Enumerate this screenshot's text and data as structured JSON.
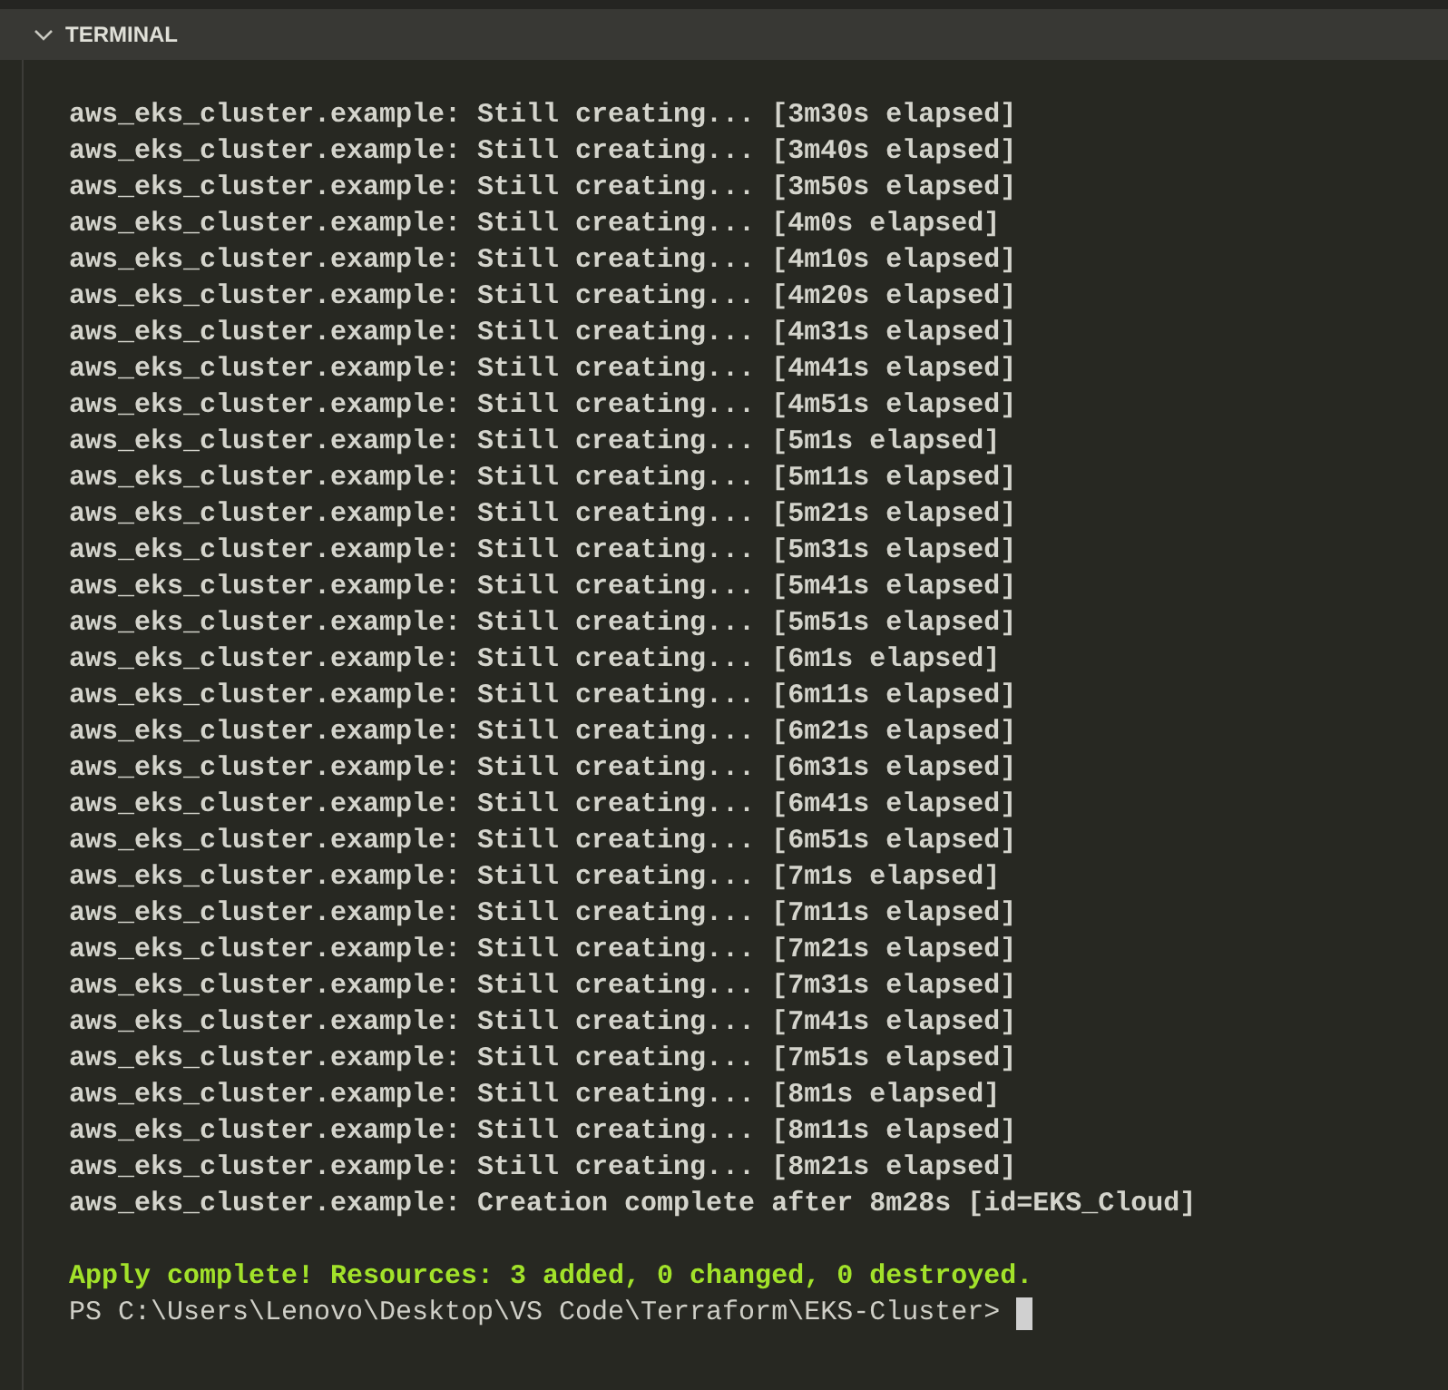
{
  "panel": {
    "title": "TERMINAL",
    "expanded": true
  },
  "terminal": {
    "blocks": [
      [
        {
          "kind": "output",
          "text": "aws_eks_cluster.example: Still creating... [3m30s elapsed]"
        },
        {
          "kind": "output",
          "text": "aws_eks_cluster.example: Still creating... [3m40s elapsed]"
        },
        {
          "kind": "output",
          "text": "aws_eks_cluster.example: Still creating... [3m50s elapsed]"
        },
        {
          "kind": "output",
          "text": "aws_eks_cluster.example: Still creating... [4m0s elapsed]"
        },
        {
          "kind": "output",
          "text": "aws_eks_cluster.example: Still creating... [4m10s elapsed]"
        },
        {
          "kind": "output",
          "text": "aws_eks_cluster.example: Still creating... [4m20s elapsed]"
        },
        {
          "kind": "output",
          "text": "aws_eks_cluster.example: Still creating... [4m31s elapsed]"
        },
        {
          "kind": "output",
          "text": "aws_eks_cluster.example: Still creating... [4m41s elapsed]"
        },
        {
          "kind": "output",
          "text": "aws_eks_cluster.example: Still creating... [4m51s elapsed]"
        },
        {
          "kind": "output",
          "text": "aws_eks_cluster.example: Still creating... [5m1s elapsed]"
        },
        {
          "kind": "output",
          "text": "aws_eks_cluster.example: Still creating... [5m11s elapsed]"
        },
        {
          "kind": "output",
          "text": "aws_eks_cluster.example: Still creating... [5m21s elapsed]"
        },
        {
          "kind": "output",
          "text": "aws_eks_cluster.example: Still creating... [5m31s elapsed]"
        },
        {
          "kind": "output",
          "text": "aws_eks_cluster.example: Still creating... [5m41s elapsed]"
        },
        {
          "kind": "output",
          "text": "aws_eks_cluster.example: Still creating... [5m51s elapsed]"
        },
        {
          "kind": "output",
          "text": "aws_eks_cluster.example: Still creating... [6m1s elapsed]"
        },
        {
          "kind": "output",
          "text": "aws_eks_cluster.example: Still creating... [6m11s elapsed]"
        },
        {
          "kind": "output",
          "text": "aws_eks_cluster.example: Still creating... [6m21s elapsed]"
        },
        {
          "kind": "output",
          "text": "aws_eks_cluster.example: Still creating... [6m31s elapsed]"
        },
        {
          "kind": "output",
          "text": "aws_eks_cluster.example: Still creating... [6m41s elapsed]"
        },
        {
          "kind": "output",
          "text": "aws_eks_cluster.example: Still creating... [6m51s elapsed]"
        },
        {
          "kind": "output",
          "text": "aws_eks_cluster.example: Still creating... [7m1s elapsed]"
        },
        {
          "kind": "output",
          "text": "aws_eks_cluster.example: Still creating... [7m11s elapsed]"
        },
        {
          "kind": "output",
          "text": "aws_eks_cluster.example: Still creating... [7m21s elapsed]"
        },
        {
          "kind": "output",
          "text": "aws_eks_cluster.example: Still creating... [7m31s elapsed]"
        },
        {
          "kind": "output",
          "text": "aws_eks_cluster.example: Still creating... [7m41s elapsed]"
        },
        {
          "kind": "output",
          "text": "aws_eks_cluster.example: Still creating... [7m51s elapsed]"
        },
        {
          "kind": "output",
          "text": "aws_eks_cluster.example: Still creating... [8m1s elapsed]"
        },
        {
          "kind": "output",
          "text": "aws_eks_cluster.example: Still creating... [8m11s elapsed]"
        },
        {
          "kind": "output",
          "text": "aws_eks_cluster.example: Still creating... [8m21s elapsed]"
        },
        {
          "kind": "output",
          "text": "aws_eks_cluster.example: Creation complete after 8m28s [id=EKS_Cloud]"
        }
      ],
      [
        {
          "kind": "success",
          "text": "Apply complete! Resources: 3 added, 0 changed, 0 destroyed."
        },
        {
          "kind": "prompt",
          "text": "PS C:\\Users\\Lenovo\\Desktop\\VS Code\\Terraform\\EKS-Cluster>"
        }
      ]
    ]
  }
}
